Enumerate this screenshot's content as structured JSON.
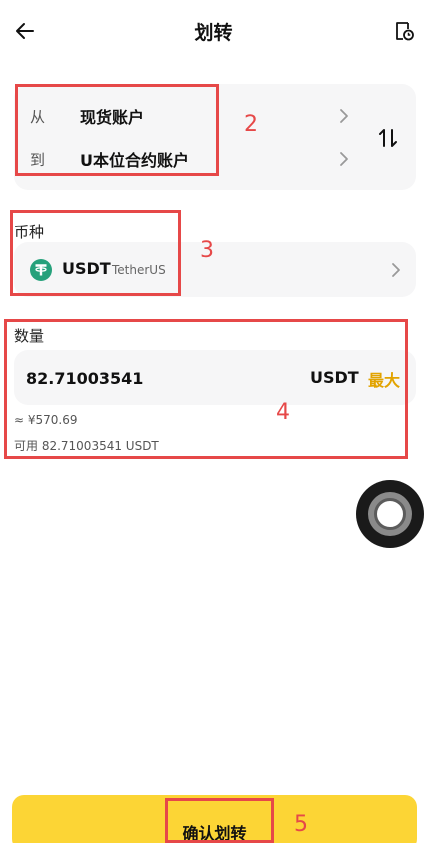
{
  "header": {
    "title": "划转",
    "back_icon": "arrow-left-icon",
    "history_icon": "clock-document-icon"
  },
  "transfer": {
    "from_label": "从",
    "from_account": "现货账户",
    "to_label": "到",
    "to_account": "U本位合约账户",
    "swap_icon": "swap-vertical-icon"
  },
  "coin": {
    "section_label": "币种",
    "symbol": "USDT",
    "name": "TetherUS",
    "icon": "tether-icon",
    "icon_color": "#26a17b"
  },
  "amount": {
    "section_label": "数量",
    "value": "82.71003541",
    "unit": "USDT",
    "max_label": "最大",
    "approx": "≈ ¥570.69",
    "available": "可用 82.71003541 USDT"
  },
  "confirm": {
    "label": "确认划转"
  },
  "annotations": {
    "n2": "2",
    "n3": "3",
    "n4": "4",
    "n5": "5"
  },
  "colors": {
    "accent": "#fcd535",
    "max": "#e2a300",
    "annotation": "#e64848"
  }
}
